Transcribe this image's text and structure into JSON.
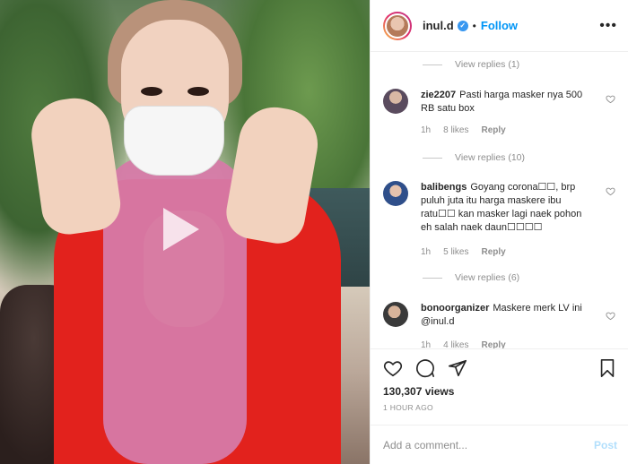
{
  "header": {
    "username": "inul.d",
    "separator": "•",
    "follow_label": "Follow",
    "more_label": "•••"
  },
  "comments": {
    "view_replies_top": "View replies (1)",
    "items": [
      {
        "username": "zie2207",
        "text": "Pasti harga masker nya 500 RB satu box",
        "time": "1h",
        "likes": "8 likes",
        "reply": "Reply",
        "view_replies": "View replies (10)"
      },
      {
        "username": "balibengs",
        "text": "Goyang corona☐☐, brp puluh juta itu harga maskere ibu ratu☐☐ kan masker lagi naek pohon eh salah naek daun☐☐☐☐",
        "time": "1h",
        "likes": "5 likes",
        "reply": "Reply",
        "view_replies": "View replies (6)"
      },
      {
        "username": "bonoorganizer",
        "text": "Maskere merk LV ini @inul.d",
        "time": "1h",
        "likes": "4 likes",
        "reply": "Reply"
      }
    ]
  },
  "actions": {
    "views": "130,307 views",
    "time": "1 HOUR AGO"
  },
  "add_comment": {
    "placeholder": "Add a comment...",
    "post_label": "Post"
  },
  "colors": {
    "accent": "#0095f6",
    "muted": "#8e8e8e",
    "post_disabled": "#b2dffc"
  }
}
